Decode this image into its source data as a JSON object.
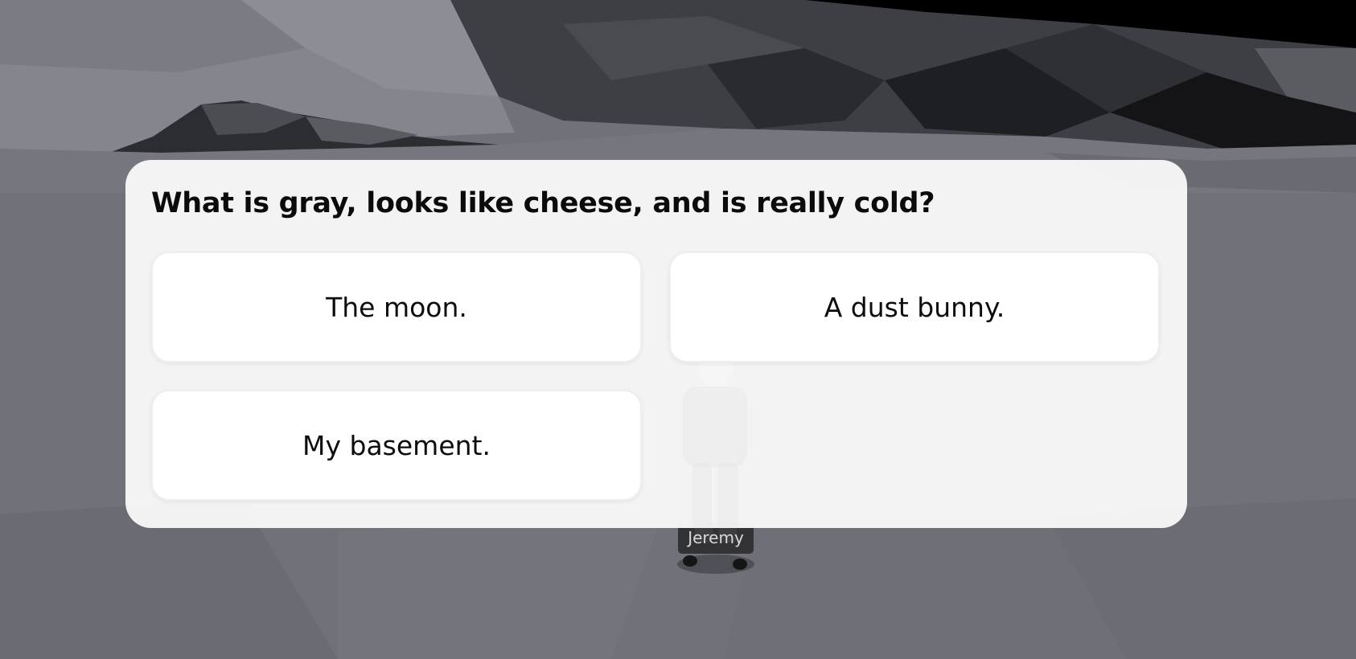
{
  "dialog": {
    "question": "What is gray, looks like cheese, and is really cold?",
    "answers": [
      {
        "label": "The moon."
      },
      {
        "label": "A dust bunny."
      },
      {
        "label": "My basement."
      }
    ]
  },
  "player": {
    "name": "Jeremy"
  },
  "colors": {
    "panel": "#f6f6f6",
    "answer_bg": "#ffffff",
    "text": "#0b0b0b",
    "nameplate_bg": "#28282c"
  }
}
